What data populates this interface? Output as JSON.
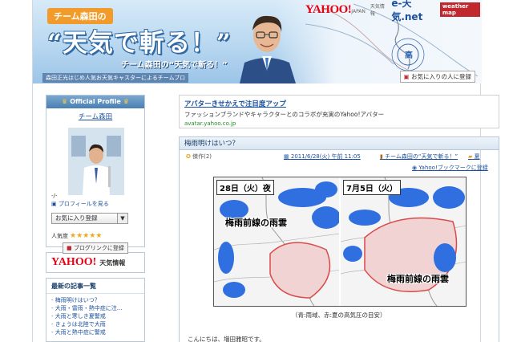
{
  "header": {
    "team_pill": "チーム森田の",
    "title": "“天気で斬る！”",
    "subtitle": "チーム森田の“天気で斬る！”",
    "tagline": "森田正光はじめ人気お天気キャスターによるチームブロ",
    "logo_yahoo": "YAHOO!",
    "logo_yahoo_sub": "JAPAN",
    "logo_tenki": "天気情報",
    "logo_etenki": "e-天気.net",
    "logo_wm": "weather map",
    "map_high_label": "高",
    "favorite_button": "お気に入りの人に登録"
  },
  "sidebar": {
    "profile_heading": "Official Profile",
    "profile_name": "チーム森田",
    "profile_dash": "-/-",
    "profile_link": "プロフィールを見る",
    "fav_button": "お気に入り登録",
    "fav_arrow": "▼",
    "popularity_label": "人気度",
    "stars": "★★★★★",
    "blog_link_button": "ブログリンクに登録",
    "yahoo_logo": "YAHOO!",
    "yahoo_label": "天気情報",
    "recent_heading": "最新の記事一覧",
    "recent_items": [
      "梅雨明けはいつ？",
      "大雨・雷雨・熱中症に注…",
      "大雨と寒しき夏警戒",
      "きょうは北陸で大雨",
      "大雨と熱中症に警戒"
    ]
  },
  "ad": {
    "title": "アバターきせかえで注目度アップ",
    "body": "ファッションブランドやキャラクターとのコラボが充実のYahoo!アバター",
    "url": "avatar.yahoo.co.jp"
  },
  "article": {
    "title": "梅雨明けはいつ？",
    "tag": "傑作(2)",
    "date": "2011/6/28(火) 午前 11:05",
    "category": "チーム森田の“天気で斬る！”",
    "summer": "夏",
    "bookmark": "Yahoo!ブックマークに登録",
    "map1_label": "28日（火）夜",
    "map1_cloud": "梅雨前線の雨雲",
    "map2_label": "7月5日（火）",
    "map2_cloud": "梅雨前線の雨雲",
    "caption": "（青:雨域、赤:夏の高気圧の目安）",
    "greeting": "こんにちは、増田雅昭です。"
  },
  "colors": {
    "accent_blue": "#1a4f9c",
    "header_blue": "#b8d7f0",
    "yahoo_red": "#e60012",
    "pill_orange": "#f29b2b",
    "rain_blue": "#2f6fe0",
    "high_red": "#d94a4a"
  }
}
